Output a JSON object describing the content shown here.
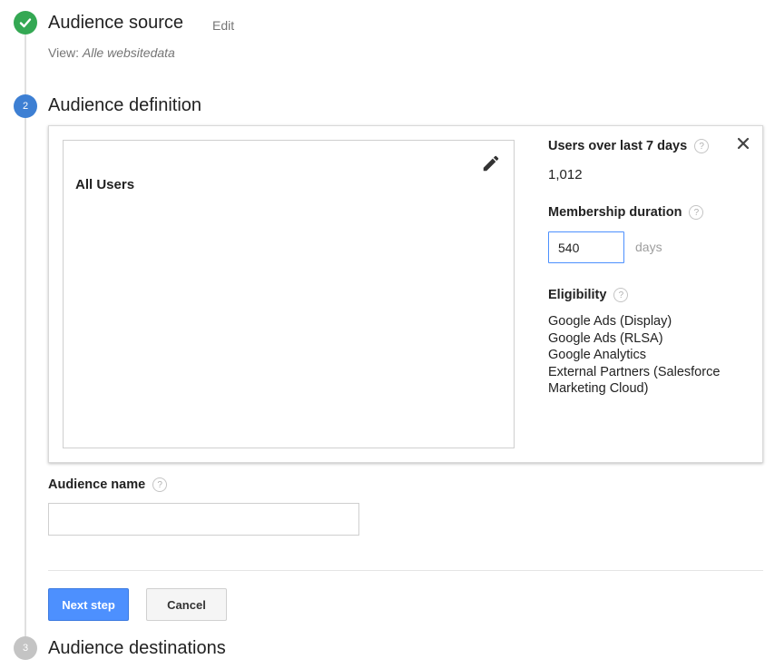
{
  "steps": {
    "source": {
      "number": "1",
      "title": "Audience source",
      "edit_label": "Edit",
      "view_prefix": "View: ",
      "view_value": "Alle websitedata",
      "status_color": "#34a853"
    },
    "definition": {
      "number": "2",
      "title": "Audience definition",
      "status_color": "#3d7fd3"
    },
    "destinations": {
      "number": "3",
      "title": "Audience destinations",
      "status_color": "#c4c4c4"
    }
  },
  "definition_panel": {
    "segment_label": "All Users",
    "users_heading": "Users over last 7 days",
    "users_count": "1,012",
    "duration_heading": "Membership duration",
    "duration_value": "540",
    "duration_unit": "days",
    "eligibility_heading": "Eligibility",
    "eligibility_items": [
      "Google Ads (Display)",
      "Google Ads (RLSA)",
      "Google Analytics",
      "External Partners (Salesforce Marketing Cloud)"
    ]
  },
  "audience_name": {
    "label": "Audience name",
    "value": ""
  },
  "actions": {
    "next_label": "Next step",
    "cancel_label": "Cancel"
  },
  "icons": {
    "check": "check-icon",
    "pencil": "pencil-icon",
    "close": "close-icon",
    "help": "help-icon"
  },
  "colors": {
    "accent": "#4d90fe",
    "input_focus": "#4d90fe"
  }
}
